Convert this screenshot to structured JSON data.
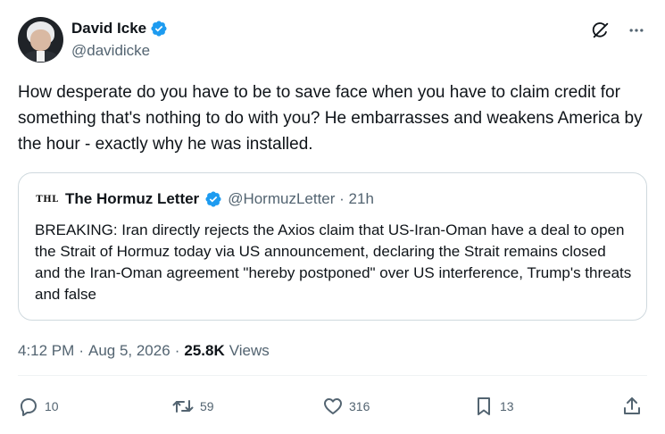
{
  "author": {
    "name": "David Icke",
    "handle": "@davidicke",
    "verified": true
  },
  "icons": {
    "verified": "verified-badge-icon",
    "grok": "grok-icon",
    "more": "more-icon",
    "reply": "reply-icon",
    "repost": "repost-icon",
    "like": "heart-icon",
    "bookmark": "bookmark-icon",
    "share": "share-icon"
  },
  "tweet": {
    "text": "How desperate do you have to be to save face when you have to claim credit for something that's nothing to do with you? He embarrasses and weakens America by the hour - exactly why he was installed."
  },
  "quote": {
    "logo_text": "THL",
    "name": "The Hormuz Letter",
    "meta": "@HormuzLetter · 21h",
    "text": "BREAKING: Iran directly rejects the Axios claim that US-Iran-Oman have a deal to open the Strait of Hormuz today via US announcement, declaring the Strait remains closed and the Iran-Oman agreement \"hereby postponed\" over US interference, Trump's threats and false"
  },
  "meta": {
    "time": "4:12 PM",
    "sep1": "·",
    "date": "Aug 5, 2026",
    "sep2": "·",
    "views_count": "25.8K",
    "views_label": "Views"
  },
  "actions": {
    "replies": "10",
    "reposts": "59",
    "likes": "316",
    "bookmarks": "13"
  },
  "colors": {
    "verified": "#1d9bf0",
    "text": "#0f1419",
    "secondary": "#536471",
    "border": "#cfd9de"
  }
}
